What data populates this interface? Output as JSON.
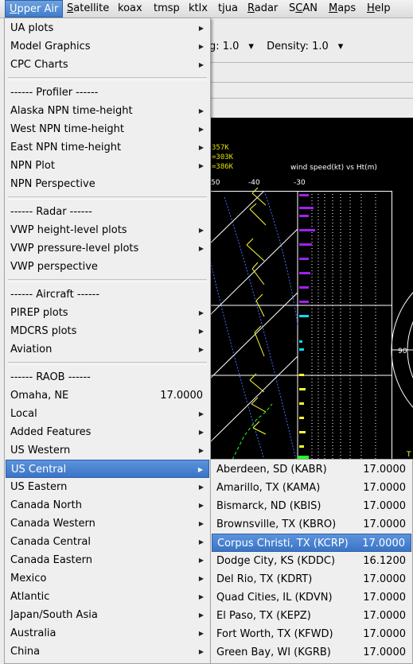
{
  "menubar": [
    "Upper Air",
    "Satellite",
    "koax",
    "tmsp",
    "ktlx",
    "tjua",
    "Radar",
    "SCAN",
    "Maps",
    "Help"
  ],
  "menubar_mnemonic": [
    "U",
    "S",
    "",
    "",
    "",
    "",
    "R",
    "C",
    "M",
    "H"
  ],
  "toolbar": {
    "mag": "ag: 1.0",
    "density": "Density: 1.0"
  },
  "plot": {
    "temps": [
      "357K",
      "=303K",
      "=386K"
    ],
    "title": "wind speed(kt) vs Ht(m)",
    "ticks": [
      "50",
      "-40",
      "-30"
    ],
    "ring_label": "90",
    "corner_label": "T"
  },
  "main_menu": [
    {
      "label": "UA plots",
      "arrow": true
    },
    {
      "label": "Model Graphics",
      "arrow": true
    },
    {
      "label": "CPC Charts",
      "arrow": true
    },
    {
      "sep": true
    },
    {
      "label": "------ Profiler ------"
    },
    {
      "label": "Alaska NPN time-height",
      "arrow": true
    },
    {
      "label": "West NPN time-height",
      "arrow": true
    },
    {
      "label": "East NPN time-height",
      "arrow": true
    },
    {
      "label": "NPN Plot",
      "arrow": true
    },
    {
      "label": "NPN Perspective"
    },
    {
      "sep": true
    },
    {
      "label": "------ Radar ------"
    },
    {
      "label": "VWP height-level plots",
      "arrow": true
    },
    {
      "label": "VWP pressure-level plots",
      "arrow": true
    },
    {
      "label": "VWP perspective"
    },
    {
      "sep": true
    },
    {
      "label": "------ Aircraft ------"
    },
    {
      "label": "PIREP plots",
      "arrow": true
    },
    {
      "label": "MDCRS plots",
      "arrow": true
    },
    {
      "label": "Aviation",
      "arrow": true
    },
    {
      "sep": true
    },
    {
      "label": "------ RAOB ------"
    },
    {
      "label": "Omaha, NE",
      "value": "17.0000"
    },
    {
      "label": "Local",
      "arrow": true
    },
    {
      "label": "Added Features",
      "arrow": true
    },
    {
      "label": "US Western",
      "arrow": true
    },
    {
      "label": "US Central",
      "arrow": true,
      "highlight": true
    },
    {
      "label": "US Eastern",
      "arrow": true
    },
    {
      "label": "Canada North",
      "arrow": true
    },
    {
      "label": "Canada Western",
      "arrow": true
    },
    {
      "label": "Canada Central",
      "arrow": true
    },
    {
      "label": "Canada Eastern",
      "arrow": true
    },
    {
      "label": "Mexico",
      "arrow": true
    },
    {
      "label": "Atlantic",
      "arrow": true
    },
    {
      "label": "Japan/South Asia",
      "arrow": true
    },
    {
      "label": "Australia",
      "arrow": true
    },
    {
      "label": "China",
      "arrow": true
    }
  ],
  "sub_menu": [
    {
      "label": "Aberdeen, SD (KABR)",
      "value": "17.0000"
    },
    {
      "label": "Amarillo, TX (KAMA)",
      "value": "17.0000"
    },
    {
      "label": "Bismarck, ND (KBIS)",
      "value": "17.0000"
    },
    {
      "label": "Brownsville, TX (KBRO)",
      "value": "17.0000"
    },
    {
      "label": "Corpus Christi, TX (KCRP)",
      "value": "17.0000",
      "highlight": true
    },
    {
      "label": "Dodge City, KS (KDDC)",
      "value": "16.1200"
    },
    {
      "label": "Del Rio, TX (KDRT)",
      "value": "17.0000"
    },
    {
      "label": "Quad Cities, IL (KDVN)",
      "value": "17.0000"
    },
    {
      "label": "El Paso, TX (KEPZ)",
      "value": "17.0000"
    },
    {
      "label": "Fort Worth, TX (KFWD)",
      "value": "17.0000"
    },
    {
      "label": "Green Bay, WI (KGRB)",
      "value": "17.0000"
    }
  ]
}
